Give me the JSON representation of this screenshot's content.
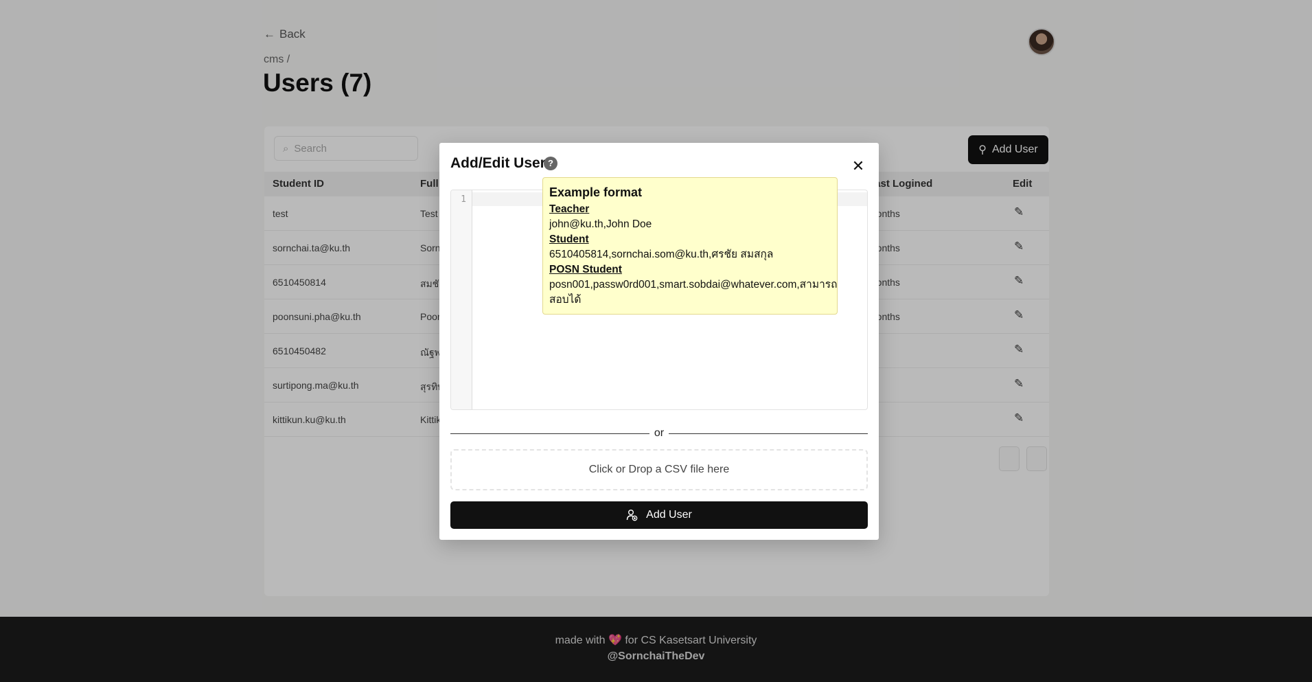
{
  "page": {
    "back_label": "Back",
    "breadcrumb": "cms /",
    "title": "Users (7)",
    "search_placeholder": "Search",
    "add_user_button": "Add User",
    "columns": [
      "Student ID",
      "Full name",
      "Last Logined",
      "Edit"
    ],
    "rows": [
      {
        "id": "test",
        "name": "Test",
        "last": "months"
      },
      {
        "id": "sornchai.ta@ku.th",
        "name": "Sornchai",
        "last": "months"
      },
      {
        "id": "6510450814",
        "name": "สมชัย",
        "last": "months"
      },
      {
        "id": "poonsuni.pha@ku.th",
        "name": "Poonsuni",
        "last": "months"
      },
      {
        "id": "6510450482",
        "name": "ณัฐพล",
        "last": ""
      },
      {
        "id": "surtipong.ma@ku.th",
        "name": "สุรทิพงศ์",
        "last": ""
      },
      {
        "id": "kittikun.ku@ku.th",
        "name": "Kittikun",
        "last": ""
      }
    ],
    "footer_line1": "made with 💖 for CS Kasetsart University",
    "footer_line2": "@SornchaiTheDev"
  },
  "modal": {
    "title": "Add/Edit User",
    "help_icon": "question-circle-icon",
    "close_icon": "close-icon",
    "editor": {
      "line_number": "1",
      "value": ""
    },
    "tooltip": {
      "title": "Example format",
      "teacher_heading": "Teacher",
      "teacher_example": "john@ku.th,John Doe",
      "student_heading": "Student",
      "student_example": "6510405814,sornchai.som@ku.th,ศรชัย สมสกุล",
      "posn_heading": "POSN Student",
      "posn_example": "posn001,passw0rd001,smart.sobdai@whatever.com,สามารถ สอบได้"
    },
    "divider_text": "or",
    "dropzone_text": "Click or Drop a CSV file here",
    "submit_label": "Add User",
    "submit_icon": "user-add-icon"
  }
}
